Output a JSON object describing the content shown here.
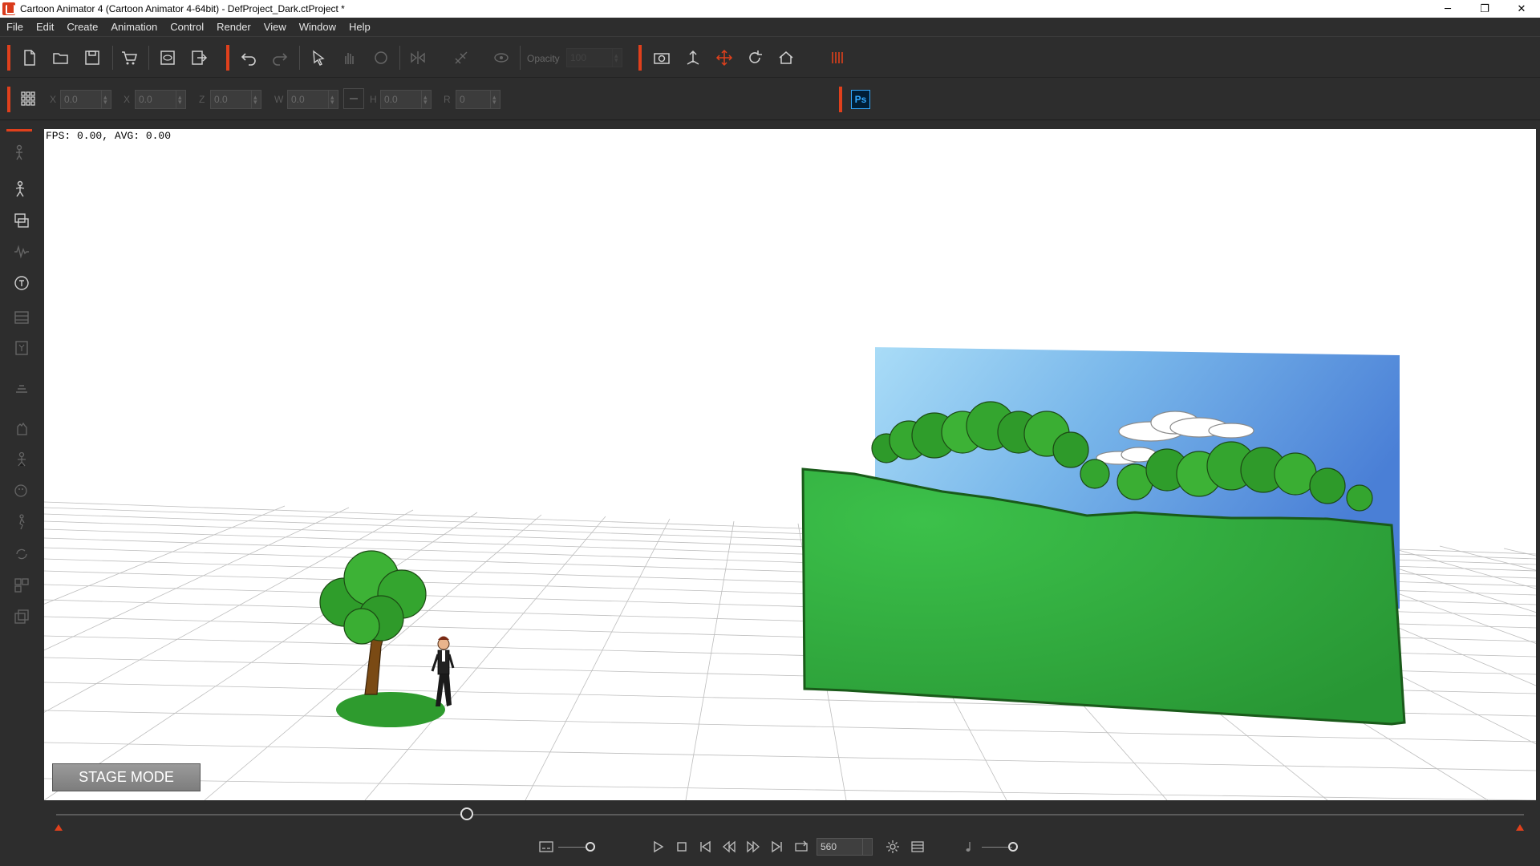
{
  "window": {
    "title": "Cartoon Animator 4  (Cartoon Animator 4-64bit) - DefProject_Dark.ctProject *",
    "controls": {
      "minimize": "─",
      "restore": "❐",
      "close": "✕"
    }
  },
  "menu": [
    "File",
    "Edit",
    "Create",
    "Animation",
    "Control",
    "Render",
    "View",
    "Window",
    "Help"
  ],
  "toolbar": {
    "opacity_label": "Opacity",
    "opacity_value": "100"
  },
  "transform": {
    "x_label": "X",
    "x_value": "0.0",
    "y_label": "Y",
    "y_value": "0.0",
    "z_label": "Z",
    "z_value": "0.0",
    "w_label": "W",
    "w_value": "0.0",
    "h_label": "H",
    "h_value": "0.0",
    "r_label": "R",
    "r_value": "0",
    "first_value": "0.0",
    "ps_label": "Ps"
  },
  "viewport": {
    "fps_text": "FPS: 0.00, AVG: 0.00",
    "mode_label": "STAGE MODE"
  },
  "playback": {
    "current_frame": "560",
    "timeline_position": 0.28
  },
  "colors": {
    "accent": "#e0401c",
    "bg": "#2d2d2d",
    "sky_top": "#8ccaf0",
    "sky_bottom": "#4a7fd6",
    "ground_green": "#37b341"
  }
}
